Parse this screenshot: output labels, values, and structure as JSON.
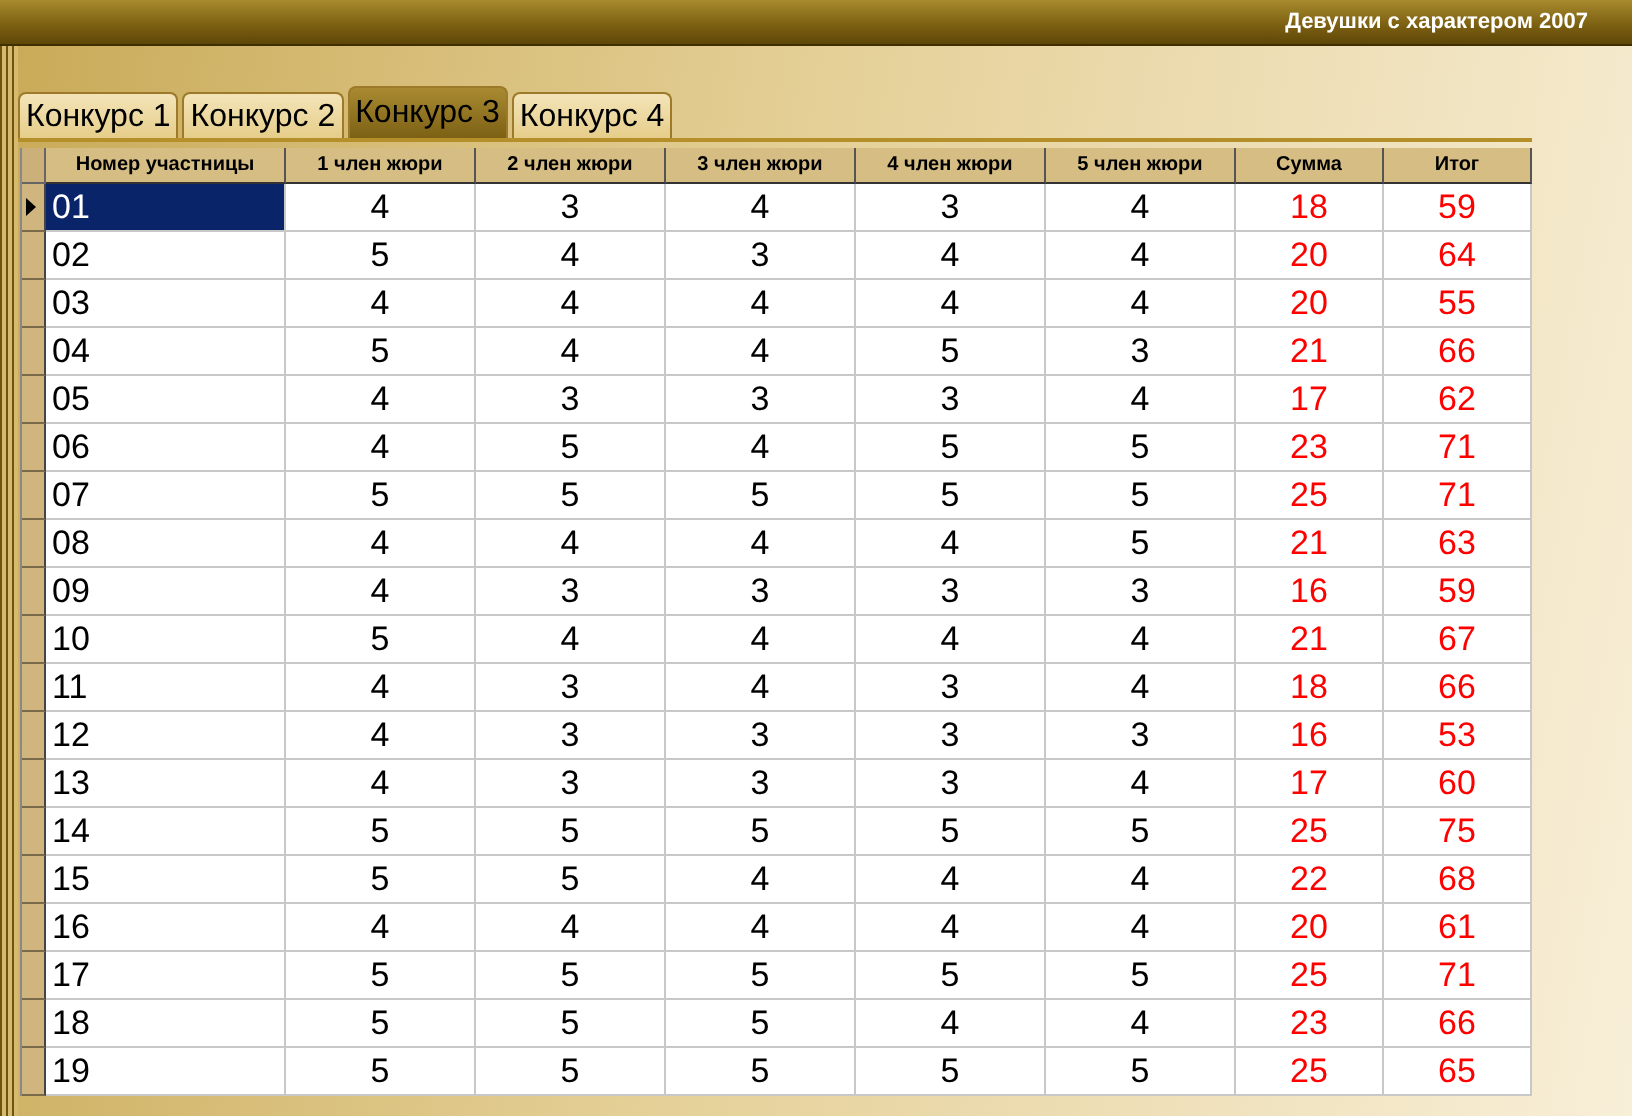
{
  "window": {
    "title": "Девушки с характером 2007"
  },
  "tabs": [
    {
      "label": "Конкурс 1",
      "selected": false
    },
    {
      "label": "Конкурс 2",
      "selected": false
    },
    {
      "label": "Конкурс 3",
      "selected": true
    },
    {
      "label": "Конкурс 4",
      "selected": false
    }
  ],
  "table": {
    "columns": [
      {
        "label": "Номер участницы",
        "kind": "id"
      },
      {
        "label": "1 член жюри",
        "kind": "score"
      },
      {
        "label": "2 член жюри",
        "kind": "score"
      },
      {
        "label": "3 член жюри",
        "kind": "score"
      },
      {
        "label": "4 член жюри",
        "kind": "score"
      },
      {
        "label": "5 член жюри",
        "kind": "score"
      },
      {
        "label": "Сумма",
        "kind": "result"
      },
      {
        "label": "Итог",
        "kind": "result"
      }
    ],
    "rows": [
      {
        "selected": true,
        "cells": [
          "01",
          "4",
          "3",
          "4",
          "3",
          "4",
          "18",
          "59"
        ]
      },
      {
        "selected": false,
        "cells": [
          "02",
          "5",
          "4",
          "3",
          "4",
          "4",
          "20",
          "64"
        ]
      },
      {
        "selected": false,
        "cells": [
          "03",
          "4",
          "4",
          "4",
          "4",
          "4",
          "20",
          "55"
        ]
      },
      {
        "selected": false,
        "cells": [
          "04",
          "5",
          "4",
          "4",
          "5",
          "3",
          "21",
          "66"
        ]
      },
      {
        "selected": false,
        "cells": [
          "05",
          "4",
          "3",
          "3",
          "3",
          "4",
          "17",
          "62"
        ]
      },
      {
        "selected": false,
        "cells": [
          "06",
          "4",
          "5",
          "4",
          "5",
          "5",
          "23",
          "71"
        ]
      },
      {
        "selected": false,
        "cells": [
          "07",
          "5",
          "5",
          "5",
          "5",
          "5",
          "25",
          "71"
        ]
      },
      {
        "selected": false,
        "cells": [
          "08",
          "4",
          "4",
          "4",
          "4",
          "5",
          "21",
          "63"
        ]
      },
      {
        "selected": false,
        "cells": [
          "09",
          "4",
          "3",
          "3",
          "3",
          "3",
          "16",
          "59"
        ]
      },
      {
        "selected": false,
        "cells": [
          "10",
          "5",
          "4",
          "4",
          "4",
          "4",
          "21",
          "67"
        ]
      },
      {
        "selected": false,
        "cells": [
          "11",
          "4",
          "3",
          "4",
          "3",
          "4",
          "18",
          "66"
        ]
      },
      {
        "selected": false,
        "cells": [
          "12",
          "4",
          "3",
          "3",
          "3",
          "3",
          "16",
          "53"
        ]
      },
      {
        "selected": false,
        "cells": [
          "13",
          "4",
          "3",
          "3",
          "3",
          "4",
          "17",
          "60"
        ]
      },
      {
        "selected": false,
        "cells": [
          "14",
          "5",
          "5",
          "5",
          "5",
          "5",
          "25",
          "75"
        ]
      },
      {
        "selected": false,
        "cells": [
          "15",
          "5",
          "5",
          "4",
          "4",
          "4",
          "22",
          "68"
        ]
      },
      {
        "selected": false,
        "cells": [
          "16",
          "4",
          "4",
          "4",
          "4",
          "4",
          "20",
          "61"
        ]
      },
      {
        "selected": false,
        "cells": [
          "17",
          "5",
          "5",
          "5",
          "5",
          "5",
          "25",
          "71"
        ]
      },
      {
        "selected": false,
        "cells": [
          "18",
          "5",
          "5",
          "5",
          "4",
          "4",
          "23",
          "66"
        ]
      },
      {
        "selected": false,
        "cells": [
          "19",
          "5",
          "5",
          "5",
          "5",
          "5",
          "25",
          "65"
        ]
      }
    ]
  }
}
